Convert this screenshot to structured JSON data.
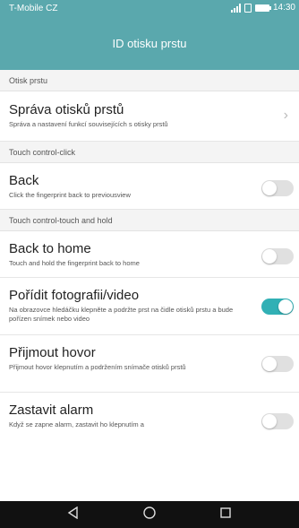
{
  "status": {
    "carrier": "T-Mobile CZ",
    "time": "14:30"
  },
  "title": "ID otisku prstu",
  "sections": [
    {
      "label": "Otisk prstu"
    },
    {
      "label": "Touch control-click"
    },
    {
      "label": "Touch control-touch and hold"
    }
  ],
  "rows": [
    {
      "title": "Správa otisků prstů",
      "subtitle": "Správa a nastavení funkcí souvisejících s otisky prstů"
    },
    {
      "title": "Back",
      "subtitle": "Click the fingerprint back to previousview",
      "enabled": false
    },
    {
      "title": "Back to home",
      "subtitle": "Touch and hold the fingerprint back to home",
      "enabled": false
    },
    {
      "title": "Pořídit fotografii/video",
      "subtitle": "Na obrazovce hledáčku klepněte a podržte prst na čidle otisků prstu a bude pořízen snímek nebo video",
      "enabled": true
    },
    {
      "title": "Přijmout hovor",
      "subtitle": "Přijmout hovor klepnutím a podržením snímače otisků prstů",
      "enabled": false
    },
    {
      "title": "Zastavit alarm",
      "subtitle": "Když se zapne alarm, zastavit ho klepnutím a",
      "enabled": false
    }
  ],
  "icons": {
    "chevron": "chevron-right-icon",
    "back": "back-triangle-icon",
    "home": "home-circle-icon",
    "recents": "recents-square-icon"
  },
  "colors": {
    "accent": "#5aa8ad",
    "toggle_on": "#31b0b5"
  }
}
